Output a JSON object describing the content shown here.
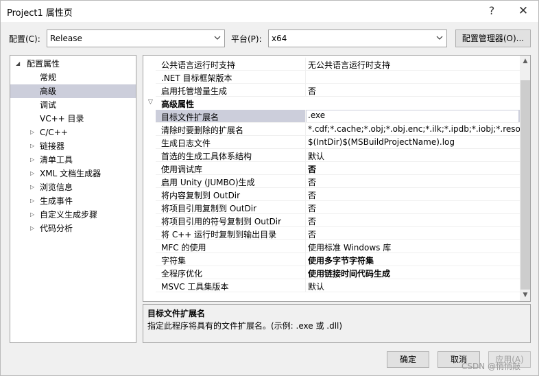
{
  "window": {
    "title": "Project1 属性页",
    "help_glyph": "?",
    "close_glyph": "✕"
  },
  "toolbar": {
    "config_label": "配置(C):",
    "config_value": "Release",
    "platform_label": "平台(P):",
    "platform_value": "x64",
    "config_manager_label": "配置管理器(O)..."
  },
  "tree": {
    "root_label": "配置属性",
    "items": [
      {
        "label": "常规"
      },
      {
        "label": "高级"
      },
      {
        "label": "调试"
      },
      {
        "label": "VC++ 目录"
      },
      {
        "label": "C/C++"
      },
      {
        "label": "链接器"
      },
      {
        "label": "清单工具"
      },
      {
        "label": "XML 文档生成器"
      },
      {
        "label": "浏览信息"
      },
      {
        "label": "生成事件"
      },
      {
        "label": "自定义生成步骤"
      },
      {
        "label": "代码分析"
      }
    ],
    "selected": "高级"
  },
  "grid": {
    "rows": [
      {
        "name": "公共语言运行时支持",
        "value": "无公共语言运行时支持"
      },
      {
        "name": ".NET 目标框架版本",
        "value": ""
      },
      {
        "name": "启用托管增量生成",
        "value": "否"
      }
    ],
    "category": "高级属性",
    "advanced_rows": [
      {
        "name": "目标文件扩展名",
        "value": ".exe"
      },
      {
        "name": "清除时要删除的扩展名",
        "value": "*.cdf;*.cache;*.obj;*.obj.enc;*.ilk;*.ipdb;*.iobj;*.resources;*.tlb;*.tli;*.tlh;*.tmp;*.rsp"
      },
      {
        "name": "生成日志文件",
        "value": "$(IntDir)$(MSBuildProjectName).log"
      },
      {
        "name": "首选的生成工具体系结构",
        "value": "默认"
      },
      {
        "name": "使用调试库",
        "value": "否"
      },
      {
        "name": "启用 Unity (JUMBO)生成",
        "value": "否"
      },
      {
        "name": "将内容复制到 OutDir",
        "value": "否"
      },
      {
        "name": "将项目引用复制到 OutDir",
        "value": "否"
      },
      {
        "name": "将项目引用的符号复制到 OutDir",
        "value": "否"
      },
      {
        "name": "将 C++ 运行时复制到输出目录",
        "value": "否"
      },
      {
        "name": "MFC 的使用",
        "value": "使用标准 Windows 库"
      },
      {
        "name": "字符集",
        "value": "使用多字节字符集"
      },
      {
        "name": "全程序优化",
        "value": "使用链接时间代码生成"
      },
      {
        "name": "MSVC 工具集版本",
        "value": "默认"
      }
    ]
  },
  "description": {
    "title": "目标文件扩展名",
    "text": "指定此程序将具有的文件扩展名。(示例: .exe 或 .dll)"
  },
  "buttons": {
    "ok": "确定",
    "cancel": "取消",
    "apply": "应用(A)"
  },
  "watermark": "CSDN @悄悄敲"
}
